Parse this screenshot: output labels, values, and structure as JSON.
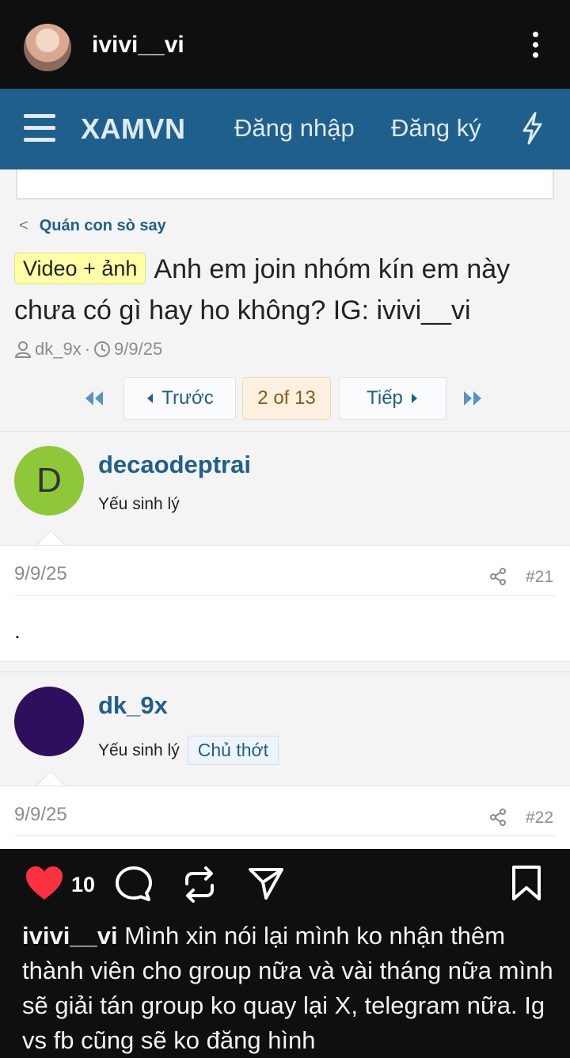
{
  "instagram": {
    "username": "ivivi__vi",
    "likes": "10",
    "caption_user": "ivivi__vi",
    "caption_text": "Mình xin nói lại mình ko nhận thêm thành viên cho group nữa và vài tháng nữa mình sẽ giải tán group ko quay lại X, telegram nữa. Ig vs fb cũng sẽ ko đăng hình"
  },
  "forum": {
    "brand": "XAMVN",
    "login": "Đăng nhập",
    "register": "Đăng ký",
    "breadcrumb": "Quán con sò say",
    "thread": {
      "prefix": "Video + ảnh",
      "title": "Anh em join nhóm kín em này chưa có gì hay ho không? IG: ivivi__vi",
      "author": "dk_9x",
      "separator": "·",
      "date": "9/9/25"
    },
    "pagination": {
      "prev": "Trước",
      "current": "2 of 13",
      "next": "Tiếp"
    },
    "posts": [
      {
        "avatar_letter": "D",
        "avatar_color": "#8fc73a",
        "username": "decaodeptrai",
        "user_title": "Yếu sinh lý",
        "date": "9/9/25",
        "number": "#21",
        "body": "."
      },
      {
        "avatar_letter": "",
        "avatar_color": "#2e0f5e",
        "username": "dk_9x",
        "user_title": "Yếu sinh lý",
        "badge": "Chủ thớt",
        "date": "9/9/25",
        "number": "#22"
      }
    ]
  },
  "colors": {
    "header": "#1f5f8b",
    "like": "#ff3040"
  }
}
